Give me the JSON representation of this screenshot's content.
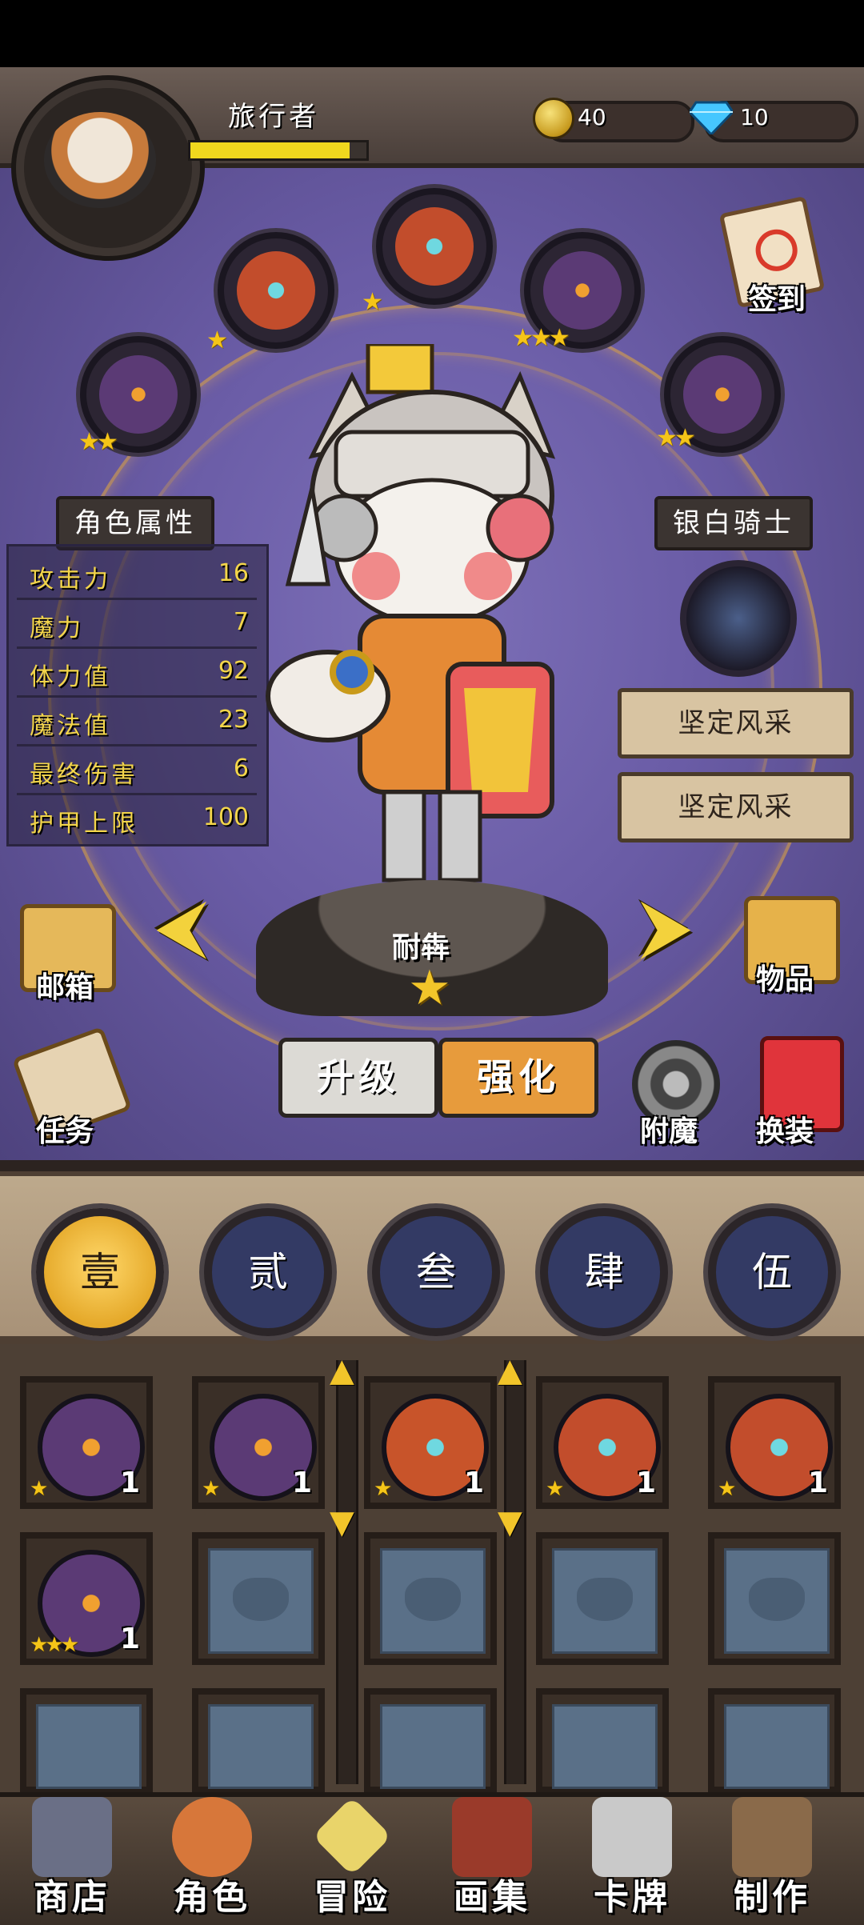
{
  "player": {
    "name": "旅行者",
    "xp_fraction": 0.93
  },
  "currency": {
    "coins": "40",
    "gems": "10"
  },
  "top_right": {
    "signin_label": "签到"
  },
  "skill_slots": [
    {
      "stars": "★★",
      "color": "#5b3a75"
    },
    {
      "stars": "★",
      "color": "#c24d2c"
    },
    {
      "stars": "★",
      "color": "#c24d2c"
    },
    {
      "stars": "★★★",
      "color": "#5b3a75"
    },
    {
      "stars": "★★",
      "color": "#5b3a75"
    }
  ],
  "attributes": {
    "title": "角色属性",
    "rows": [
      {
        "name": "攻击力",
        "value": "16"
      },
      {
        "name": "魔力",
        "value": "7"
      },
      {
        "name": "体力值",
        "value": "92"
      },
      {
        "name": "魔法值",
        "value": "23"
      },
      {
        "name": "最终伤害",
        "value": "6"
      },
      {
        "name": "护甲上限",
        "value": "100"
      }
    ]
  },
  "character": {
    "class_name": "银白骑士",
    "skills": [
      "坚定风采",
      "坚定风采"
    ],
    "title": "耐犇",
    "star": "★"
  },
  "side_actions": {
    "mailbox": "邮箱",
    "quests": "任务",
    "items": "物品",
    "enchant": "附魔",
    "outfit": "换装"
  },
  "buttons": {
    "upgrade": "升级",
    "enhance": "强化"
  },
  "tabs": [
    "壹",
    "贰",
    "叁",
    "肆",
    "伍"
  ],
  "inventory": [
    {
      "stars": "★",
      "count": "1",
      "color": "#5b3a75"
    },
    {
      "stars": "★",
      "count": "1",
      "color": "#5b3a75"
    },
    {
      "stars": "★",
      "count": "1",
      "color": "#c8542a"
    },
    {
      "stars": "★",
      "count": "1",
      "color": "#c24d2c"
    },
    {
      "stars": "★",
      "count": "1",
      "color": "#c24d2c"
    },
    {
      "stars": "★★★",
      "count": "1",
      "color": "#5b3a75"
    }
  ],
  "nav": [
    "商店",
    "角色",
    "冒险",
    "画集",
    "卡牌",
    "制作"
  ],
  "colors": {
    "accent_gold": "#f2c52a",
    "stage_purple": "#6a5ca6"
  }
}
